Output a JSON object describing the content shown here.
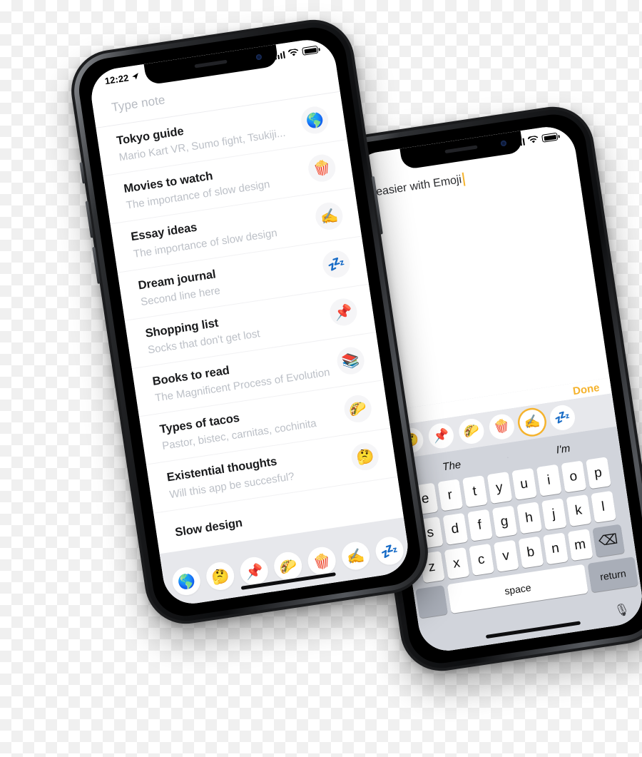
{
  "front_phone": {
    "status_bar": {
      "time": "12:22",
      "location_icon": "location-arrow-icon",
      "signal_icon": "cellular-signal-icon",
      "wifi_icon": "wifi-icon",
      "battery_icon": "battery-full-icon"
    },
    "compose_placeholder": "Type note",
    "notes": [
      {
        "title": "Tokyo guide",
        "subtitle": "Mario Kart VR, Sumo fight, Tsukiji...",
        "emoji": "🌎",
        "emoji_name": "globe-emoji"
      },
      {
        "title": "Movies to watch",
        "subtitle": "The importance of slow design",
        "emoji": "🍿",
        "emoji_name": "popcorn-emoji"
      },
      {
        "title": "Essay ideas",
        "subtitle": "The importance of slow design",
        "emoji": "✍️",
        "emoji_name": "writing-hand-emoji"
      },
      {
        "title": "Dream journal",
        "subtitle": "Second line here",
        "emoji": "💤",
        "emoji_name": "zzz-emoji"
      },
      {
        "title": "Shopping list",
        "subtitle": "Socks that don't get lost",
        "emoji": "📌",
        "emoji_name": "pushpin-emoji"
      },
      {
        "title": "Books to read",
        "subtitle": "The Magnificent Process of Evolution",
        "emoji": "📚",
        "emoji_name": "books-emoji"
      },
      {
        "title": "Types of tacos",
        "subtitle": "Pastor, bistec, carnitas, cochinita",
        "emoji": "🌮",
        "emoji_name": "taco-emoji"
      },
      {
        "title": "Existential thoughts",
        "subtitle": "Will this app be succesful?",
        "emoji": "🤔",
        "emoji_name": "thinking-face-emoji"
      },
      {
        "title": "Slow design",
        "subtitle": "",
        "emoji": "",
        "emoji_name": "none"
      }
    ],
    "emoji_bar": [
      {
        "emoji": "🌎",
        "name": "globe-emoji"
      },
      {
        "emoji": "🤔",
        "name": "thinking-face-emoji"
      },
      {
        "emoji": "📌",
        "name": "pushpin-emoji"
      },
      {
        "emoji": "🌮",
        "name": "taco-emoji"
      },
      {
        "emoji": "🍿",
        "name": "popcorn-emoji"
      },
      {
        "emoji": "✍️",
        "name": "writing-hand-emoji"
      },
      {
        "emoji": "💤",
        "name": "zzz-emoji"
      }
    ]
  },
  "back_phone": {
    "status_bar": {
      "signal_icon": "cellular-signal-icon",
      "wifi_icon": "wifi-icon",
      "battery_icon": "battery-full-icon"
    },
    "editor_text": "t easier with Emoji",
    "done_label": "Done",
    "emoji_bar": [
      {
        "emoji": "🤔",
        "name": "thinking-face-emoji",
        "selected": false
      },
      {
        "emoji": "📌",
        "name": "pushpin-emoji",
        "selected": false
      },
      {
        "emoji": "🌮",
        "name": "taco-emoji",
        "selected": false
      },
      {
        "emoji": "🍿",
        "name": "popcorn-emoji",
        "selected": false
      },
      {
        "emoji": "✍️",
        "name": "writing-hand-emoji",
        "selected": true
      },
      {
        "emoji": "💤",
        "name": "zzz-emoji",
        "selected": false
      }
    ],
    "predictions": [
      "The",
      "I'm"
    ],
    "keyboard": {
      "row1": [
        "e",
        "r",
        "t",
        "y",
        "u",
        "i",
        "o",
        "p"
      ],
      "row2": [
        "s",
        "d",
        "f",
        "g",
        "h",
        "j",
        "k",
        "l"
      ],
      "row3": [
        "z",
        "x",
        "c",
        "v",
        "b",
        "n",
        "m"
      ],
      "backspace_icon": "⌫",
      "space_label": "space",
      "return_label": "return",
      "mic_icon": "🎙"
    }
  },
  "colors": {
    "accent": "#f5b32d",
    "title": "#191a1c",
    "subtitle": "#bcc0c7",
    "keyboard_bg": "#d1d4db",
    "emoji_bar_bg": "#e7e8ec"
  }
}
